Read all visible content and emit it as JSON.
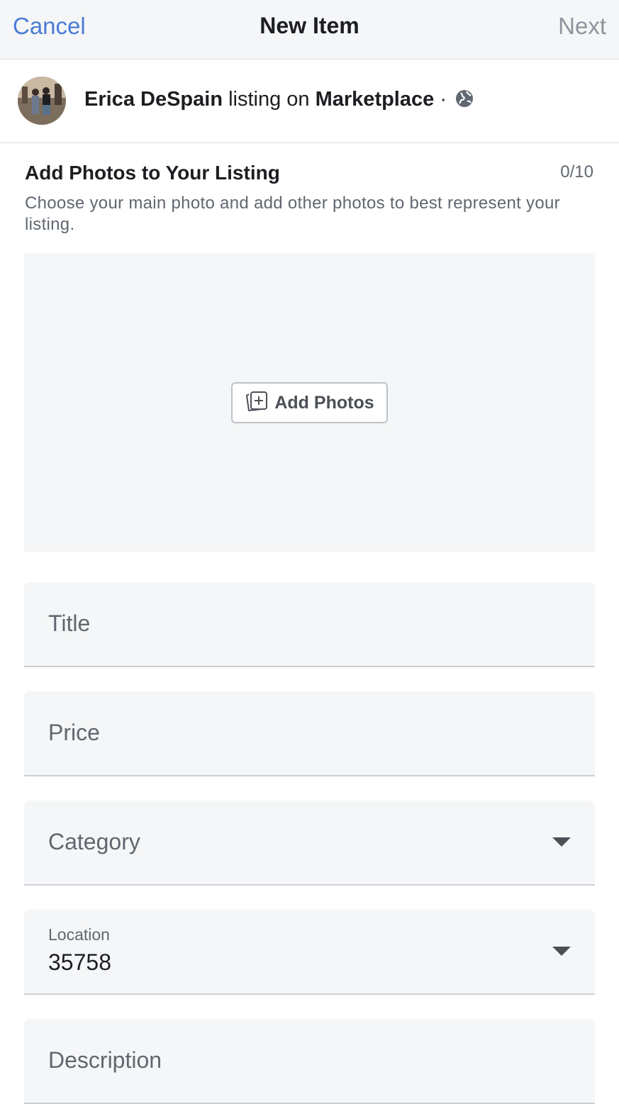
{
  "nav": {
    "cancel_label": "Cancel",
    "title": "New Item",
    "next_label": "Next"
  },
  "poster": {
    "name": "Erica DeSpain",
    "middle_text": " listing on ",
    "destination": "Marketplace",
    "separator": " ·",
    "privacy_icon": "globe-icon"
  },
  "photos": {
    "heading": "Add Photos to Your Listing",
    "count": "0/10",
    "description": "Choose your main photo and add other photos to best represent your listing.",
    "add_button_label": "Add Photos",
    "add_button_icon": "add-photo-icon"
  },
  "form": {
    "title_placeholder": "Title",
    "price_placeholder": "Price",
    "category_placeholder": "Category",
    "category_icon": "chevron-down-icon",
    "location_label": "Location",
    "location_value": "35758",
    "location_icon": "chevron-down-icon",
    "description_placeholder": "Description"
  },
  "colors": {
    "link_blue": "#4b7bd5",
    "disabled_gray": "#8d949e",
    "field_bg": "#f5f6f7"
  }
}
